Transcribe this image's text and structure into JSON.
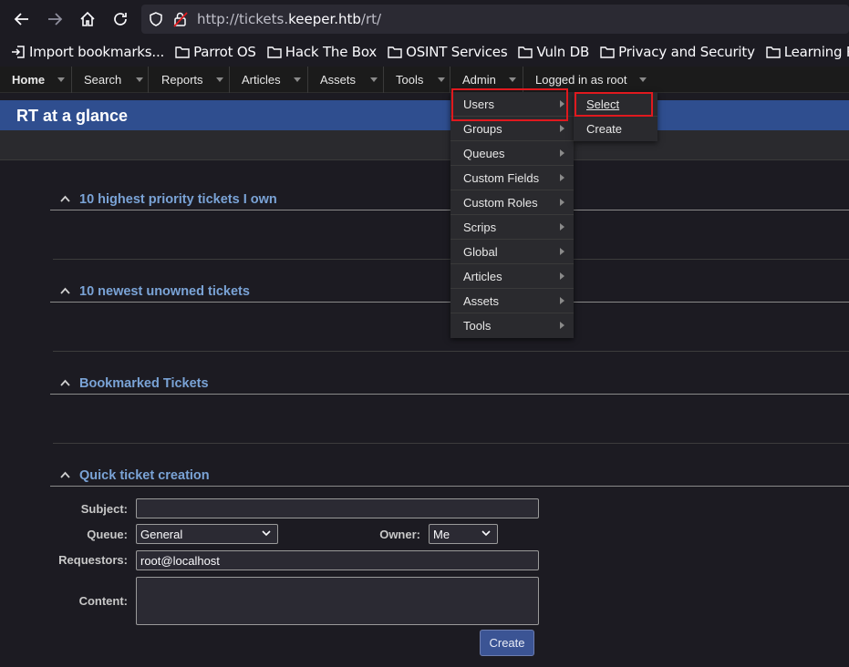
{
  "browser": {
    "url_scheme": "http://tickets.",
    "url_host": "keeper.htb",
    "url_path": "/rt/",
    "bookmarks": [
      {
        "label": "Import bookmarks...",
        "icon": "import-icon"
      },
      {
        "label": "Parrot OS",
        "icon": "folder-icon"
      },
      {
        "label": "Hack The Box",
        "icon": "folder-icon"
      },
      {
        "label": "OSINT Services",
        "icon": "folder-icon"
      },
      {
        "label": "Vuln DB",
        "icon": "folder-icon"
      },
      {
        "label": "Privacy and Security",
        "icon": "folder-icon"
      },
      {
        "label": "Learning Resources",
        "icon": "folder-icon"
      }
    ]
  },
  "menu": {
    "home": "Home",
    "search": "Search",
    "reports": "Reports",
    "articles": "Articles",
    "assets": "Assets",
    "tools": "Tools",
    "admin": "Admin",
    "logged_in": "Logged in as root"
  },
  "page": {
    "title": "RT at a glance"
  },
  "portlets": [
    "10 highest priority tickets I own",
    "10 newest unowned tickets",
    "Bookmarked Tickets",
    "Quick ticket creation"
  ],
  "quick_ticket": {
    "subject_label": "Subject:",
    "subject_value": "",
    "queue_label": "Queue:",
    "queue_value": "General",
    "owner_label": "Owner:",
    "owner_value": "Me",
    "requestors_label": "Requestors:",
    "requestors_value": "root@localhost",
    "content_label": "Content:",
    "content_value": "",
    "create_button": "Create"
  },
  "admin_menu": {
    "items": [
      "Users",
      "Groups",
      "Queues",
      "Custom Fields",
      "Custom Roles",
      "Scrips",
      "Global",
      "Articles",
      "Assets",
      "Tools"
    ],
    "highlighted": "Users"
  },
  "users_submenu": {
    "items": [
      "Select",
      "Create"
    ],
    "highlighted": "Select"
  },
  "colors": {
    "accent_blue": "#2f4e8f",
    "portlet_title": "#7aa3d6",
    "highlight_box": "#e0191e"
  }
}
